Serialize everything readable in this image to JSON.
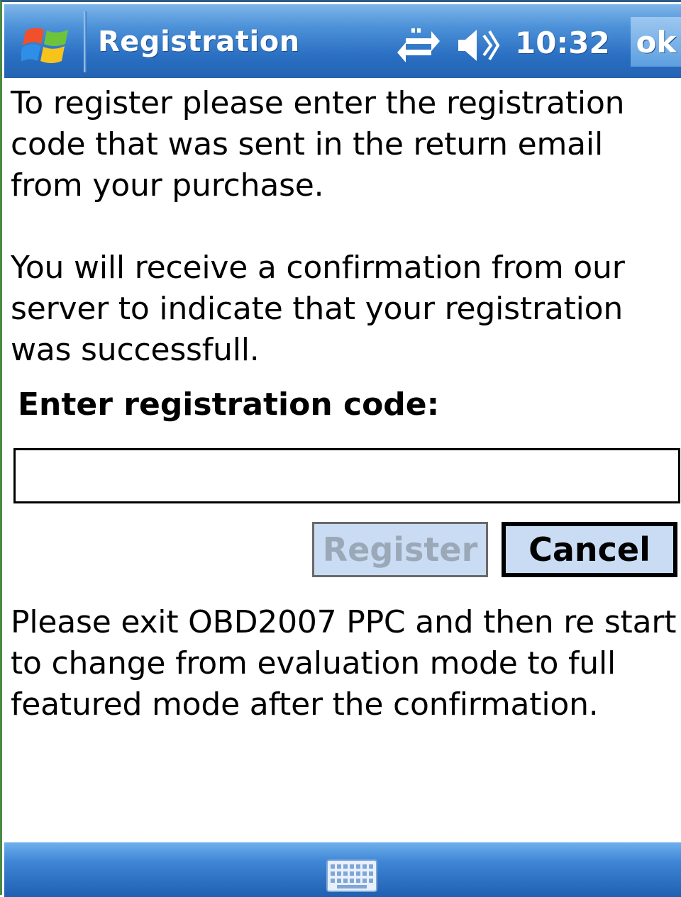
{
  "titlebar": {
    "start_icon": "windows-flag-icon",
    "title": "Registration",
    "connectivity_icon": "connectivity-icon",
    "volume_icon": "volume-icon",
    "time": "10:32",
    "ok_label": "ok"
  },
  "content": {
    "instruction_1": "To register please enter the registration code that was sent in the return email from your purchase.",
    "instruction_2": "You will receive a confirmation from our server to indicate that your registration was successfull.",
    "code_label": "Enter registration code:",
    "code_value": "",
    "register_label": "Register",
    "register_enabled": false,
    "cancel_label": "Cancel",
    "instruction_3": "Please exit OBD2007 PPC and then re start to change from evaluation mode to full featured mode after the confirmation."
  },
  "bottombar": {
    "keyboard_icon": "keyboard-icon"
  },
  "colors": {
    "titlebar_blue": "#2a6fc2",
    "button_face": "#c9dcf3",
    "disabled_text": "#9ba8b8"
  }
}
